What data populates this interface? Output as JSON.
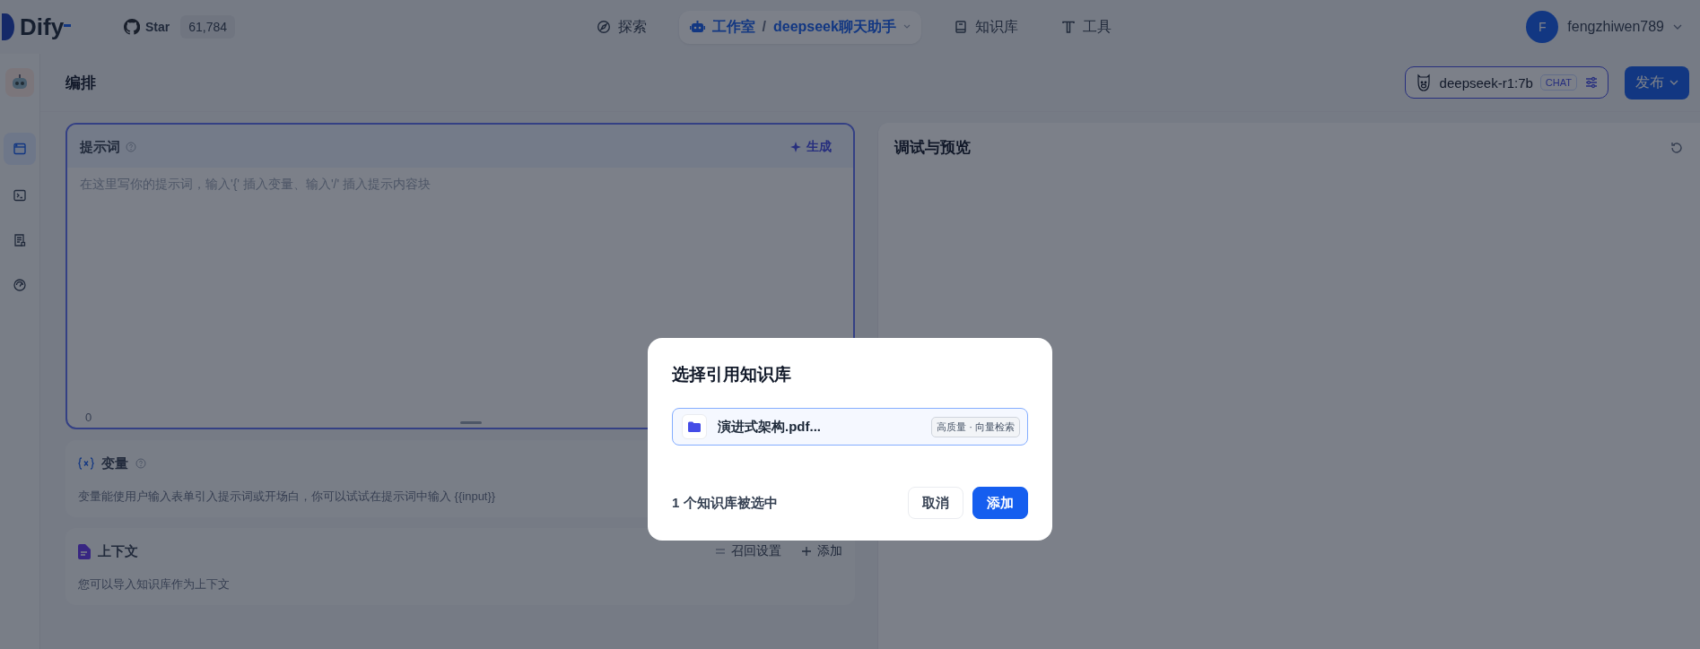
{
  "topbar": {
    "logo": "Dify",
    "star_label": "Star",
    "star_count": "61,784",
    "nav": [
      {
        "kind": "link",
        "label": "探索",
        "selected": false
      },
      {
        "kind": "app",
        "label": "工作室",
        "separator": "/",
        "app_name": "deepseek聊天助手",
        "selected": true
      },
      {
        "kind": "link",
        "label": "知识库",
        "selected": false
      },
      {
        "kind": "link",
        "label": "工具",
        "selected": false
      }
    ],
    "user": {
      "initial": "F",
      "name": "fengzhiwen789"
    }
  },
  "sidebar": {
    "items": [
      {
        "selected": true
      },
      {
        "selected": false
      },
      {
        "selected": false
      },
      {
        "selected": false
      }
    ]
  },
  "header": {
    "title": "编排",
    "model": {
      "name": "deepseek-r1:7b",
      "mode": "CHAT"
    },
    "publish": "发布"
  },
  "prompt": {
    "title": "提示词",
    "generate": "生成",
    "placeholder": "在这里写你的提示词，输入'{' 插入变量、输入'/' 插入提示内容块",
    "count": "0"
  },
  "variables": {
    "title": "变量",
    "description": "变量能使用户输入表单引入提示词或开场白，你可以试试在提示词中输入 {{input}}"
  },
  "context": {
    "title": "上下文",
    "retrieval_settings": "召回设置",
    "add": "添加",
    "description": "您可以导入知识库作为上下文"
  },
  "preview": {
    "title": "调试与预览"
  },
  "dialog": {
    "title": "选择引用知识库",
    "items": [
      {
        "name": "演进式架构.pdf...",
        "tag": "高质量 · 向量检索",
        "selected": true
      }
    ],
    "summary": "1 个知识库被选中",
    "buttons": [
      {
        "label": "取消",
        "kind": "secondary"
      },
      {
        "label": "添加",
        "kind": "primary"
      }
    ]
  }
}
